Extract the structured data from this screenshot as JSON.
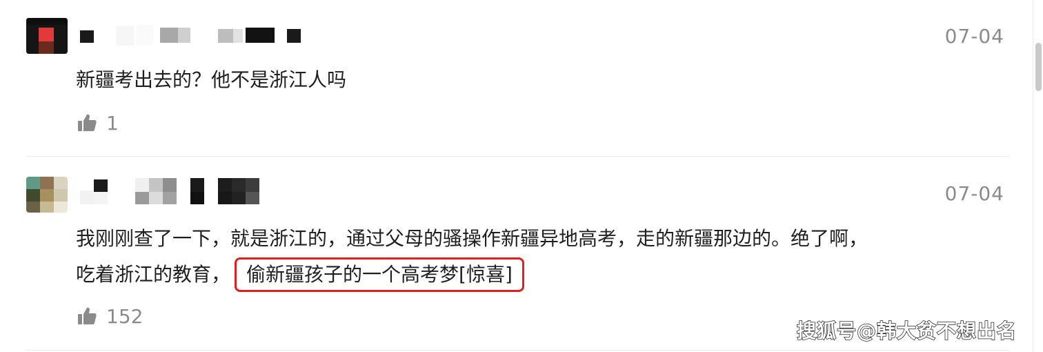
{
  "comments": [
    {
      "date": "07-04",
      "text_lines": [
        "新疆考出去的？他不是浙江人吗"
      ],
      "likes": "1"
    },
    {
      "date": "07-04",
      "text_line_1": "我刚刚查了一下，就是浙江的，通过父母的骚操作新疆异地高考，走的新疆那边的。绝了啊，",
      "text_line_2_plain": "吃着浙江的教育，",
      "text_line_2_highlight": "偷新疆孩子的一个高考梦[惊喜]",
      "likes": "152"
    }
  ],
  "watermark": "搜狐号@韩大贫不想出名",
  "icons": {
    "like": "thumbs-up-icon"
  },
  "colors": {
    "text": "#1f1f1f",
    "meta": "#8a8a8a",
    "highlight_border": "#e02020",
    "divider": "#ebebeb"
  }
}
